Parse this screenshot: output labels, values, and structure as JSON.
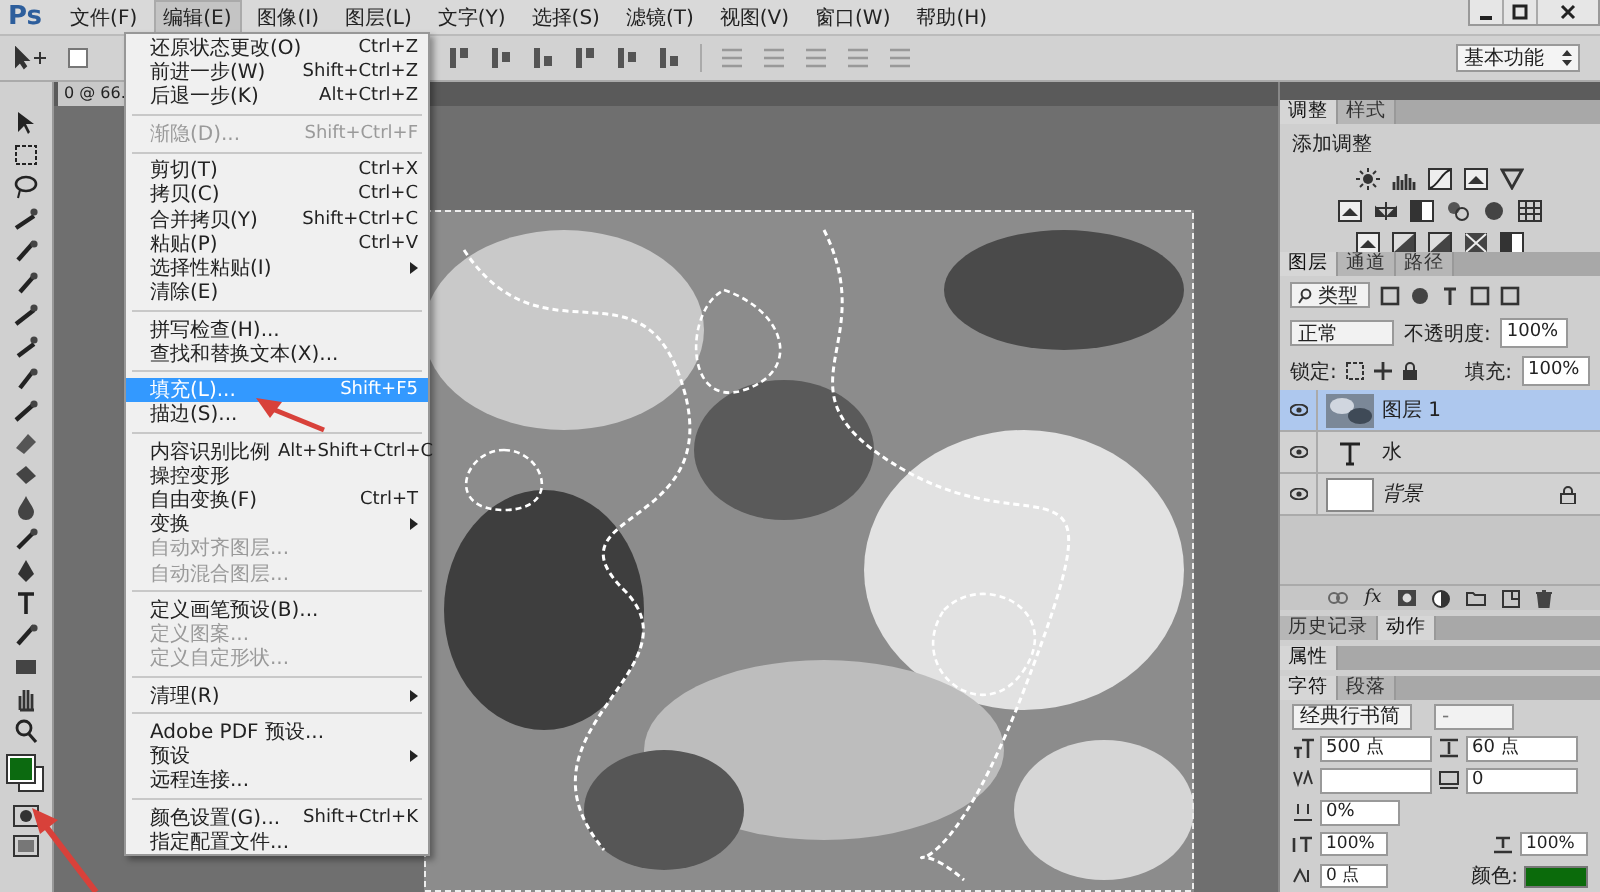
{
  "menubar": {
    "logo": "Ps",
    "items": [
      {
        "label": "文件(F)",
        "selected": false
      },
      {
        "label": "编辑(E)",
        "selected": true
      },
      {
        "label": "图像(I)",
        "selected": false
      },
      {
        "label": "图层(L)",
        "selected": false
      },
      {
        "label": "文字(Y)",
        "selected": false
      },
      {
        "label": "选择(S)",
        "selected": false
      },
      {
        "label": "滤镜(T)",
        "selected": false
      },
      {
        "label": "视图(V)",
        "selected": false
      },
      {
        "label": "窗口(W)",
        "selected": false
      },
      {
        "label": "帮助(H)",
        "selected": false
      }
    ]
  },
  "options_bar": {
    "checkbox_checked": false,
    "workspace": "基本功能"
  },
  "document_tab": {
    "title": "0 @ 66."
  },
  "edit_menu": {
    "groups": [
      [
        {
          "label": "还原状态更改(O)",
          "shortcut": "Ctrl+Z",
          "disabled": false,
          "selected": false,
          "submenu": false
        },
        {
          "label": "前进一步(W)",
          "shortcut": "Shift+Ctrl+Z",
          "disabled": false,
          "selected": false,
          "submenu": false
        },
        {
          "label": "后退一步(K)",
          "shortcut": "Alt+Ctrl+Z",
          "disabled": false,
          "selected": false,
          "submenu": false
        }
      ],
      [
        {
          "label": "渐隐(D)...",
          "shortcut": "Shift+Ctrl+F",
          "disabled": true,
          "selected": false,
          "submenu": false
        }
      ],
      [
        {
          "label": "剪切(T)",
          "shortcut": "Ctrl+X",
          "disabled": false,
          "selected": false,
          "submenu": false
        },
        {
          "label": "拷贝(C)",
          "shortcut": "Ctrl+C",
          "disabled": false,
          "selected": false,
          "submenu": false
        },
        {
          "label": "合并拷贝(Y)",
          "shortcut": "Shift+Ctrl+C",
          "disabled": false,
          "selected": false,
          "submenu": false
        },
        {
          "label": "粘贴(P)",
          "shortcut": "Ctrl+V",
          "disabled": false,
          "selected": false,
          "submenu": false
        },
        {
          "label": "选择性粘贴(I)",
          "disabled": false,
          "selected": false,
          "submenu": true
        },
        {
          "label": "清除(E)",
          "disabled": false,
          "selected": false,
          "submenu": false
        }
      ],
      [
        {
          "label": "拼写检查(H)...",
          "disabled": false,
          "selected": false,
          "submenu": false
        },
        {
          "label": "查找和替换文本(X)...",
          "disabled": false,
          "selected": false,
          "submenu": false
        }
      ],
      [
        {
          "label": "填充(L)...",
          "shortcut": "Shift+F5",
          "disabled": false,
          "selected": true,
          "submenu": false
        },
        {
          "label": "描边(S)...",
          "disabled": false,
          "selected": false,
          "submenu": false
        }
      ],
      [
        {
          "label": "内容识别比例",
          "shortcut": "Alt+Shift+Ctrl+C",
          "disabled": false,
          "selected": false,
          "submenu": false
        },
        {
          "label": "操控变形",
          "disabled": false,
          "selected": false,
          "submenu": false
        },
        {
          "label": "自由变换(F)",
          "shortcut": "Ctrl+T",
          "disabled": false,
          "selected": false,
          "submenu": false
        },
        {
          "label": "变换",
          "disabled": false,
          "selected": false,
          "submenu": true
        },
        {
          "label": "自动对齐图层...",
          "disabled": true,
          "selected": false,
          "submenu": false
        },
        {
          "label": "自动混合图层...",
          "disabled": true,
          "selected": false,
          "submenu": false
        }
      ],
      [
        {
          "label": "定义画笔预设(B)...",
          "disabled": false,
          "selected": false,
          "submenu": false
        },
        {
          "label": "定义图案...",
          "disabled": true,
          "selected": false,
          "submenu": false
        },
        {
          "label": "定义自定形状...",
          "disabled": true,
          "selected": false,
          "submenu": false
        }
      ],
      [
        {
          "label": "清理(R)",
          "disabled": false,
          "selected": false,
          "submenu": true
        }
      ],
      [
        {
          "label": "Adobe PDF 预设...",
          "disabled": false,
          "selected": false,
          "submenu": false
        },
        {
          "label": "预设",
          "disabled": false,
          "selected": false,
          "submenu": true
        },
        {
          "label": "远程连接...",
          "disabled": false,
          "selected": false,
          "submenu": false
        }
      ],
      [
        {
          "label": "颜色设置(G)...",
          "shortcut": "Shift+Ctrl+K",
          "disabled": false,
          "selected": false,
          "submenu": false
        },
        {
          "label": "指定配置文件...",
          "disabled": false,
          "selected": false,
          "submenu": false
        }
      ]
    ]
  },
  "adjustments_panel": {
    "tabs": [
      {
        "label": "调整",
        "selected": true
      },
      {
        "label": "样式",
        "selected": false
      }
    ],
    "title": "添加调整"
  },
  "layers_panel": {
    "tabs": [
      {
        "label": "图层",
        "selected": true
      },
      {
        "label": "通道",
        "selected": false
      },
      {
        "label": "路径",
        "selected": false
      }
    ],
    "filter": "类型",
    "blend_mode": "正常",
    "opacity_label": "不透明度:",
    "opacity": "100%",
    "lock_label": "锁定:",
    "fill_label": "填充:",
    "fill": "100%",
    "footer_label": "fx",
    "layers": [
      {
        "name": "图层 1",
        "kind": "pixel",
        "selected": true,
        "visible": true,
        "locked": false
      },
      {
        "name": "水",
        "kind": "text",
        "selected": false,
        "visible": true,
        "locked": false
      },
      {
        "name": "背景",
        "kind": "background",
        "selected": false,
        "visible": true,
        "locked": true
      }
    ]
  },
  "history_panel": {
    "tabs": [
      {
        "label": "历史记录",
        "selected": false
      },
      {
        "label": "动作",
        "selected": true
      }
    ]
  },
  "properties_panel": {
    "tabs": [
      {
        "label": "属性",
        "selected": true
      }
    ]
  },
  "character_panel": {
    "tabs": [
      {
        "label": "字符",
        "selected": true
      },
      {
        "label": "段落",
        "selected": false
      }
    ],
    "font": "经典行书简",
    "style": "-",
    "size": "500 点",
    "leading": "60 点",
    "tracking": "0",
    "tsume": "0%",
    "vertical_scale": "100%",
    "horizontal_scale": "100%",
    "baseline": "0 点",
    "color_label": "颜色:",
    "color": "#0b6b0b"
  }
}
